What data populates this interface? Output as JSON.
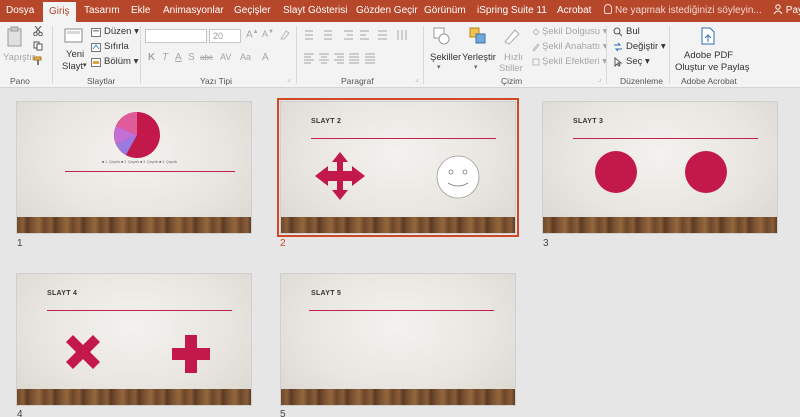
{
  "tabs": [
    {
      "label": "Dosya"
    },
    {
      "label": "Giriş"
    },
    {
      "label": "Tasarım"
    },
    {
      "label": "Ekle"
    },
    {
      "label": "Animasyonlar"
    },
    {
      "label": "Geçişler"
    },
    {
      "label": "Slayt Gösterisi"
    },
    {
      "label": "Gözden Geçir"
    },
    {
      "label": "Görünüm"
    },
    {
      "label": "iSpring Suite 11"
    },
    {
      "label": "Acrobat"
    }
  ],
  "tell_me": "Ne yapmak istediğinizi söyleyin...",
  "share_label": "Pay",
  "ribbon": {
    "pano": {
      "paste": "Yapıştır",
      "group": "Pano"
    },
    "slides": {
      "new_slide_1": "Yeni",
      "new_slide_2": "Slayt",
      "layout": "Düzen",
      "reset": "Sıfırla",
      "section": "Bölüm",
      "group": "Slaytlar"
    },
    "font": {
      "size": "20",
      "bold": "K",
      "italic": "T",
      "underline": "A",
      "shadow": "S",
      "strike": "abc",
      "case": "Aa",
      "group": "Yazı Tipi"
    },
    "paragraph": {
      "group": "Paragraf"
    },
    "drawing": {
      "shapes": "Şekiller",
      "arrange": "Yerleştir",
      "quick_styles_1": "Hızlı",
      "quick_styles_2": "Stiller",
      "fill": "Şekil Dolgusu",
      "outline": "Şekil Anahattı",
      "effects": "Şekil Efektleri",
      "group": "Çizim"
    },
    "editing": {
      "find": "Bul",
      "replace": "Değiştir",
      "select": "Seç",
      "group": "Düzenleme"
    },
    "acrobat": {
      "create_1": "Adobe PDF",
      "create_2": "Oluştur ve Paylaş",
      "group": "Adobe Acrobat"
    }
  },
  "slides": [
    {
      "number": "1",
      "title": "",
      "legend": "■ 1. Çeyrek  ■ 2. Çeyrek  ■ 3. Çeyrek  ■ 4. Çeyrek"
    },
    {
      "number": "2",
      "title": "SLAYT 2"
    },
    {
      "number": "3",
      "title": "SLAYT 3"
    },
    {
      "number": "4",
      "title": "SLAYT 4"
    },
    {
      "number": "5",
      "title": "SLAYT 5"
    }
  ],
  "colors": {
    "accent": "#b7472a",
    "shape": "#c2184a",
    "selection": "#d24726"
  }
}
